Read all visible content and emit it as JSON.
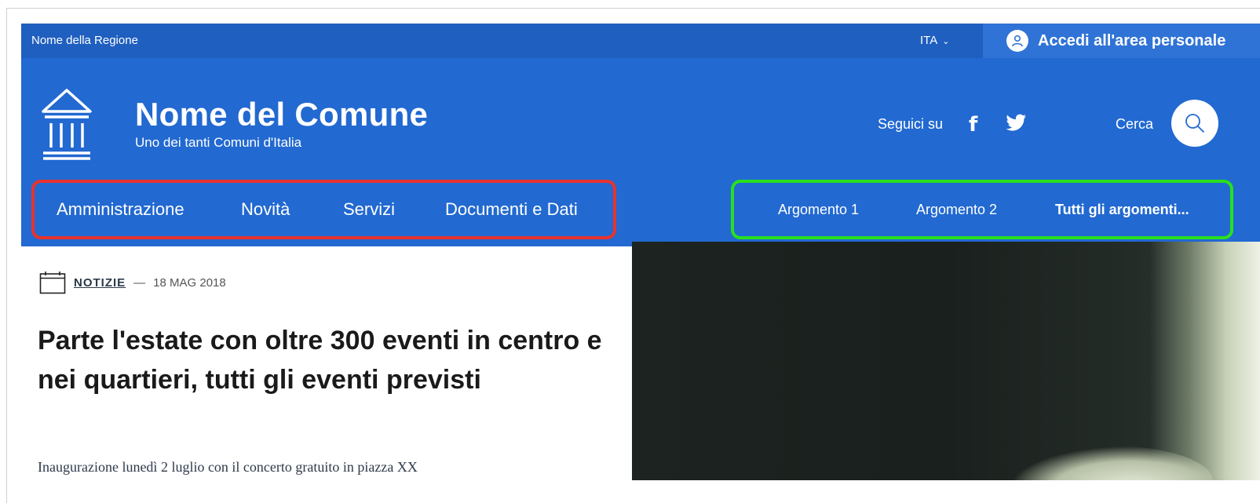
{
  "topbar": {
    "region": "Nome della Regione",
    "language": "ITA",
    "login_label": "Accedi all'area personale"
  },
  "header": {
    "site_name": "Nome del Comune",
    "tagline": "Uno dei tanti Comuni d'Italia",
    "social_label": "Seguici su",
    "search_label": "Cerca"
  },
  "nav": {
    "main": [
      "Amministrazione",
      "Novità",
      "Servizi",
      "Documenti e Dati"
    ],
    "topics": [
      "Argomento 1",
      "Argomento 2",
      "Tutti gli argomenti..."
    ]
  },
  "article": {
    "category": "NOTIZIE",
    "separator": "—",
    "date": "18 MAG 2018",
    "title": "Parte l'estate con oltre 300 eventi in centro e nei quartieri, tutti gli eventi previsti",
    "excerpt": "Inaugurazione lunedì 2 luglio con il concerto gratuito in piazza XX"
  },
  "colors": {
    "header_blue": "#2269d1",
    "topbar_blue": "#1f5fbf",
    "highlight_red": "#e8322d",
    "highlight_green": "#28e01e"
  },
  "icons": {
    "logo": "municipal-building-icon",
    "login": "user-icon",
    "search": "search-icon",
    "facebook": "facebook-icon",
    "twitter": "twitter-icon",
    "calendar": "calendar-icon"
  }
}
